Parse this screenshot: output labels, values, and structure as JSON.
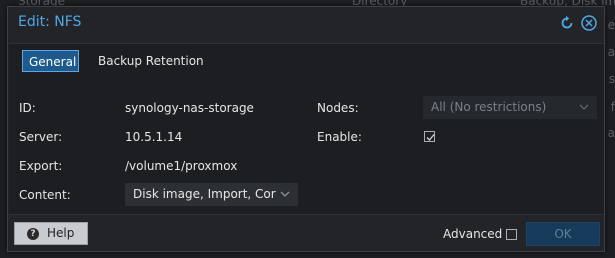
{
  "background": {
    "top_columns": [
      "Storage",
      "Directory",
      "Backup, Disk ima"
    ],
    "right_edge": [
      "e",
      "a",
      "s",
      "f",
      "a"
    ]
  },
  "dialog": {
    "title": "Edit: NFS",
    "tabs": [
      {
        "label": "General",
        "active": true
      },
      {
        "label": "Backup Retention",
        "active": false
      }
    ],
    "fields": {
      "id": {
        "label": "ID:",
        "value": "synology-nas-storage"
      },
      "server": {
        "label": "Server:",
        "value": "10.5.1.14"
      },
      "export": {
        "label": "Export:",
        "value": "/volume1/proxmox"
      },
      "content": {
        "label": "Content:",
        "value": "Disk image, Import, Cor"
      },
      "nodes": {
        "label": "Nodes:",
        "value": "All (No restrictions)"
      },
      "enable": {
        "label": "Enable:",
        "checked": true
      }
    },
    "footer": {
      "help_label": "Help",
      "advanced_label": "Advanced",
      "advanced_checked": false,
      "ok_label": "OK"
    }
  },
  "colors": {
    "accent": "#4ea8e8",
    "active_tab_bg": "#1e5a8e",
    "ok_button_bg": "#163a5a",
    "dialog_bg": "#222427"
  }
}
